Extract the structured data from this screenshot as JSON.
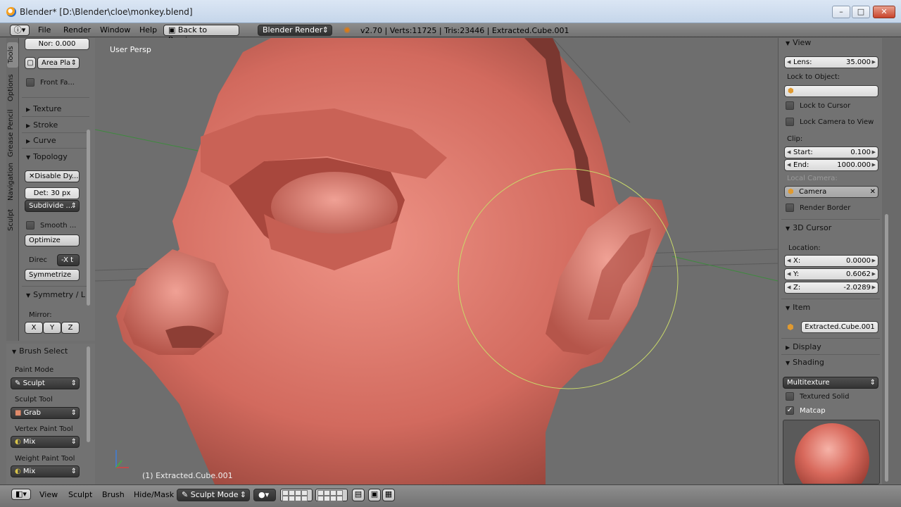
{
  "window": {
    "title": "Blender* [D:\\Blender\\cloe\\monkey.blend]",
    "minimize": "–",
    "maximize": "□",
    "close": "✕"
  },
  "info_header": {
    "menus": [
      "File",
      "Render",
      "Window",
      "Help"
    ],
    "back_button": "Back to Previous",
    "render_engine": "Blender Render",
    "stats": "v2.70 | Verts:11725 | Tris:23446 | Extracted.Cube.001"
  },
  "viewport": {
    "view_label": "User Persp",
    "object_label": "(1) Extracted.Cube.001"
  },
  "left_tabs": [
    "Tools",
    "Options",
    "Grease Pencil",
    "Navigation",
    "Sculpt"
  ],
  "toolshelf": {
    "normal_field": "Nor: 0.000",
    "area_plane": "Area Pla",
    "front_faces": "Front Fa...",
    "texture": "Texture",
    "stroke": "Stroke",
    "curve": "Curve",
    "topology": "Topology",
    "disable_dyntopo": "Disable Dy...",
    "detail": "Det: 30 px",
    "subdivide": "Subdivide ...",
    "smooth": "Smooth ...",
    "optimize": "Optimize",
    "direction_label": "Direc",
    "direction_value": "-X t",
    "symmetrize": "Symmetrize",
    "symmetry": "Symmetry / L",
    "mirror_label": "Mirror:",
    "mirror_x": "X",
    "mirror_y": "Y",
    "mirror_z": "Z"
  },
  "brush_select": {
    "header": "Brush Select",
    "paint_mode_label": "Paint Mode",
    "paint_mode_value": "Sculpt",
    "sculpt_tool_label": "Sculpt Tool",
    "sculpt_tool_value": "Grab",
    "vertex_paint_label": "Vertex Paint Tool",
    "vertex_paint_value": "Mix",
    "weight_paint_label": "Weight Paint Tool",
    "weight_paint_value": "Mix"
  },
  "properties": {
    "view_header": "View",
    "lens_key": "Lens:",
    "lens_value": "35.000",
    "lock_to_object": "Lock to Object:",
    "lock_to_cursor": "Lock to Cursor",
    "lock_camera_to_view": "Lock Camera to View",
    "clip_label": "Clip:",
    "start_key": "Start:",
    "start_value": "0.100",
    "end_key": "End:",
    "end_value": "1000.000",
    "local_camera": "Local Camera:",
    "camera_value": "Camera",
    "render_border": "Render Border",
    "cursor_header": "3D Cursor",
    "location_label": "Location:",
    "x_key": "X:",
    "x_value": "0.0000",
    "y_key": "Y:",
    "y_value": "0.6062",
    "z_key": "Z:",
    "z_value": "-2.0289",
    "item_header": "Item",
    "item_name": "Extracted.Cube.001",
    "display_header": "Display",
    "shading_header": "Shading",
    "shading_mode": "Multitexture",
    "textured_solid": "Textured Solid",
    "matcap": "Matcap"
  },
  "bottom_header": {
    "menus": [
      "View",
      "Sculpt",
      "Brush",
      "Hide/Mask"
    ],
    "mode": "Sculpt Mode"
  },
  "colors": {
    "skin": "#d9756a",
    "panel": "#727272",
    "viewport": "#6e6e6e",
    "brush_circle": "#c9d96a"
  }
}
